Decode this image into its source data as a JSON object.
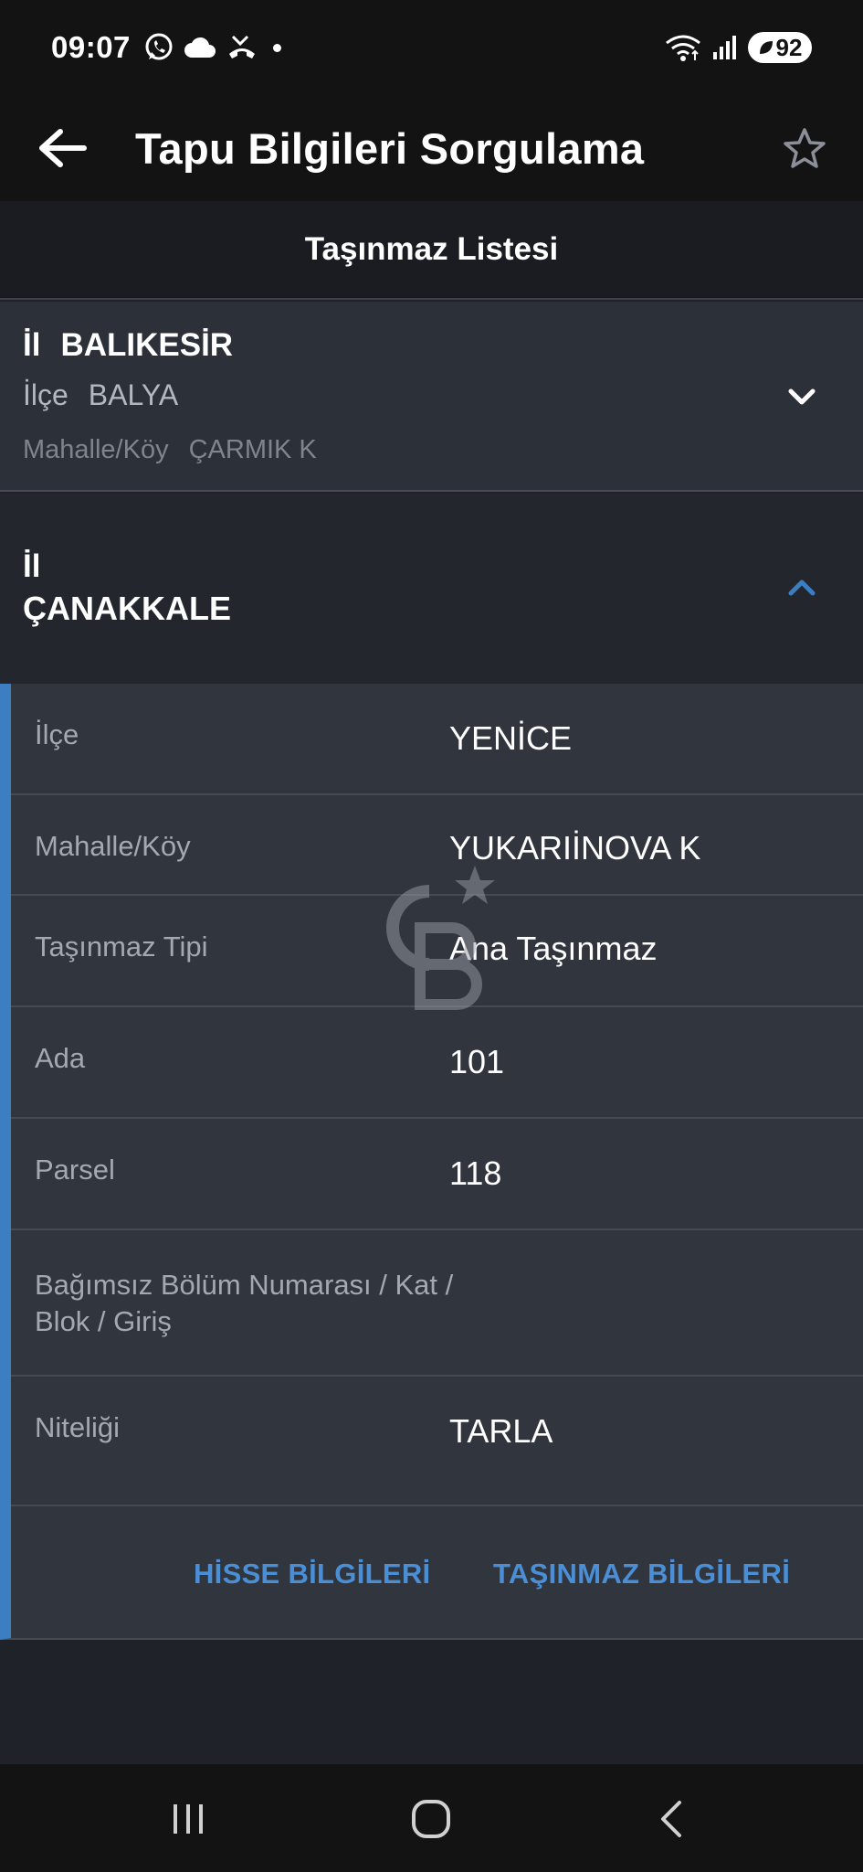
{
  "status_bar": {
    "time": "09:07",
    "battery": "92",
    "icons": [
      "whatsapp-icon",
      "cloud-icon",
      "missed-call-icon",
      "wifi-icon",
      "signal-icon",
      "battery-icon"
    ]
  },
  "app_bar": {
    "title": "Tapu Bilgileri Sorgulama",
    "back_icon": "arrow-left-icon",
    "favorite_icon": "star-outline-icon"
  },
  "sub_header": {
    "title": "Taşınmaz Listesi"
  },
  "cards": [
    {
      "il_label": "İl",
      "il_value": "BALIKESİR",
      "ilce_label": "İlçe",
      "ilce_value": "BALYA",
      "mahalle_label": "Mahalle/Köy",
      "mahalle_value": "ÇARMIK K",
      "expanded": false
    },
    {
      "il_label": "İl",
      "il_value": "ÇANAKKALE",
      "expanded": true,
      "details": [
        {
          "label": "İlçe",
          "value": "YENİCE"
        },
        {
          "label": "Mahalle/Köy",
          "value": "YUKARIİNOVA K"
        },
        {
          "label": "Taşınmaz Tipi",
          "value": "Ana Taşınmaz"
        },
        {
          "label": "Ada",
          "value": "101"
        },
        {
          "label": "Parsel",
          "value": "118"
        },
        {
          "label": "Bağımsız Bölüm Numarası / Kat / Blok / Giriş",
          "value": ""
        },
        {
          "label": "Niteliği",
          "value": "TARLA"
        }
      ],
      "actions": {
        "hisse": "HİSSE BİLGİLERİ",
        "tasinmaz": "TAŞINMAZ BİLGİLERİ"
      }
    }
  ],
  "colors": {
    "accent": "#3b7ec2",
    "action_text": "#4a8fd6",
    "background": "#1f2228",
    "card": "#2c3038"
  }
}
